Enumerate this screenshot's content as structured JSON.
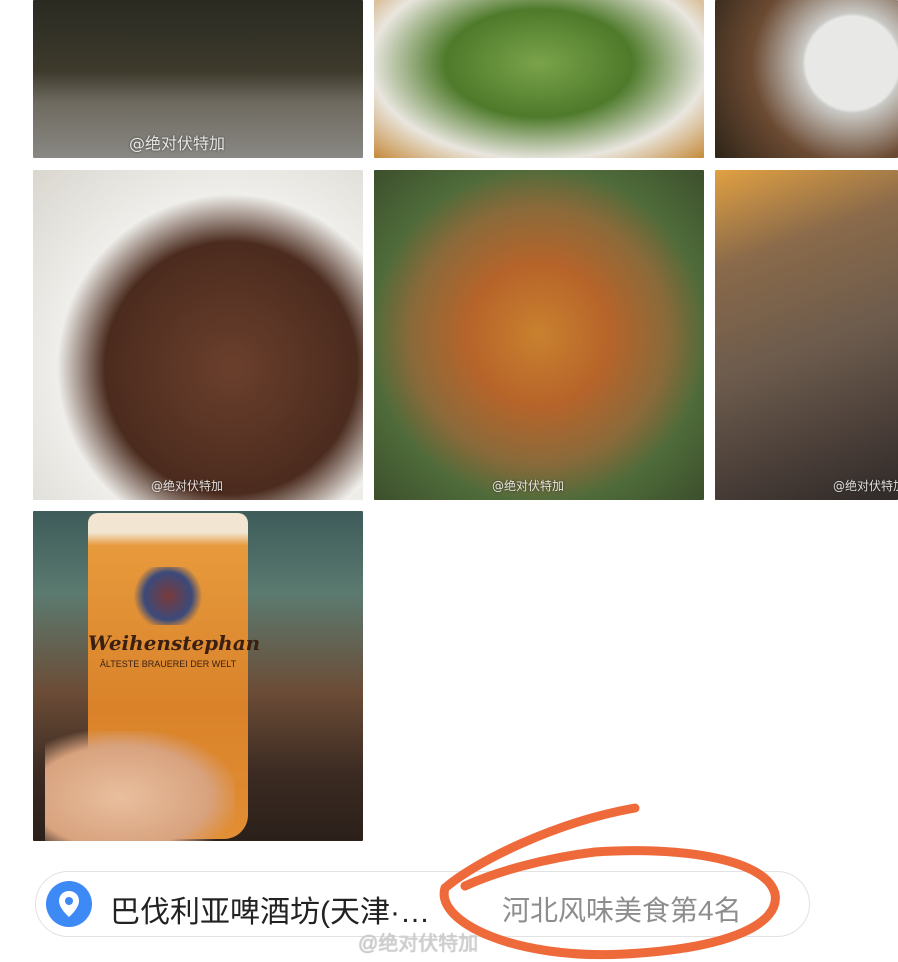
{
  "photos": [
    {
      "id": "p1",
      "watermark": "@绝对伏特加",
      "subject": "restaurant-interior-photo"
    },
    {
      "id": "p2",
      "watermark": "",
      "subject": "salad-photo"
    },
    {
      "id": "p3",
      "watermark": "",
      "subject": "dessert-photo"
    },
    {
      "id": "p4",
      "watermark": "@绝对伏特加",
      "subject": "steak-photo"
    },
    {
      "id": "p5",
      "watermark": "@绝对伏特加",
      "subject": "rice-dish-photo"
    },
    {
      "id": "p6",
      "watermark": "@绝对伏特加",
      "subject": "pastry-photo"
    },
    {
      "id": "p7",
      "watermark": "",
      "subject": "beer-photo"
    }
  ],
  "beer_glass": {
    "brand": "Weihenstephan",
    "sub": "ÄLTESTE BRAUEREI DER WELT"
  },
  "poi": {
    "icon": "location-pin-icon",
    "name": "巴伐利亚啤酒坊(天津·…",
    "rank": "河北风味美食第4名"
  },
  "bottom_watermark": "@绝对伏特加",
  "colors": {
    "pin": "#3d8af7",
    "annotation": "#ef6a3a"
  }
}
